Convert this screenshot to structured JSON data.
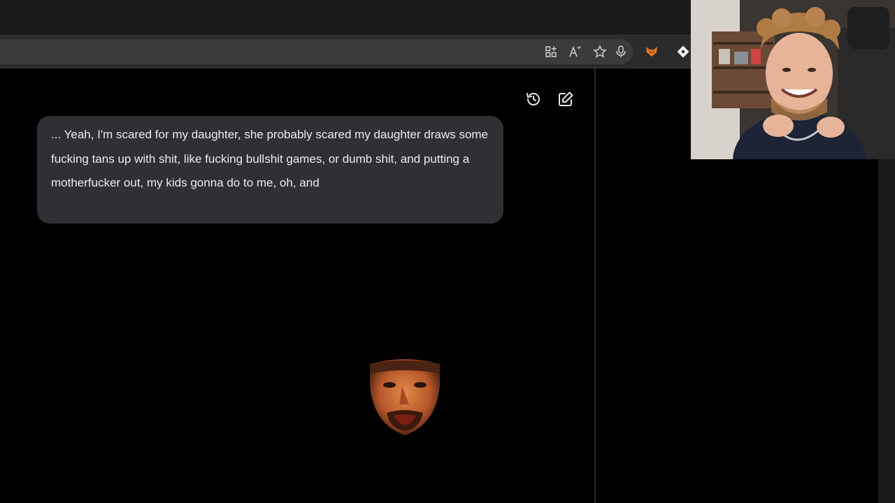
{
  "toolbar": {
    "icons": [
      "app-grid-add-icon",
      "read-aloud-icon",
      "favorite-star-icon",
      "microphone-icon",
      "fox-extension-icon",
      "diamond-extension-icon"
    ]
  },
  "chat": {
    "header_icons": [
      "history-icon",
      "new-chat-edit-icon"
    ],
    "message": "... Yeah, I'm scared for my daughter, she probably scared my daughter draws some fucking tans up with shit, like fucking bullshit games, or dumb shit, and putting a motherfucker out, my kids gonna do to me, oh, and"
  },
  "overlay": {
    "emote": "laughing-face-emote",
    "webcam": "streamer-webcam-feed"
  },
  "colors": {
    "background": "#000000",
    "bubble": "#2f3033",
    "text": "#ececec",
    "toolbar": "#2b2b2b"
  }
}
